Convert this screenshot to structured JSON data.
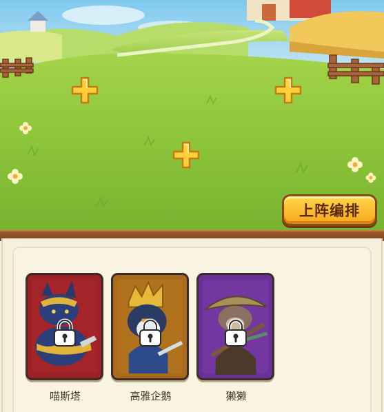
{
  "formation_button": {
    "label": "上阵编排"
  },
  "slots": [
    {
      "state": "empty"
    },
    {
      "state": "empty"
    },
    {
      "state": "empty"
    }
  ],
  "heroes": [
    {
      "name": "喵斯塔",
      "locked": true,
      "card_color": "#8f1e22"
    },
    {
      "name": "高雅企鹅",
      "locked": true,
      "card_color": "#a8661a"
    },
    {
      "name": "獭獭",
      "locked": true,
      "card_color": "#6a2f95"
    }
  ],
  "colors": {
    "grass": "#8cc43a",
    "sky": "#9fd6ef",
    "plus": "#ffcf3a",
    "button_gold": "#ffc52f",
    "panel_bg": "#f7f0dd"
  }
}
